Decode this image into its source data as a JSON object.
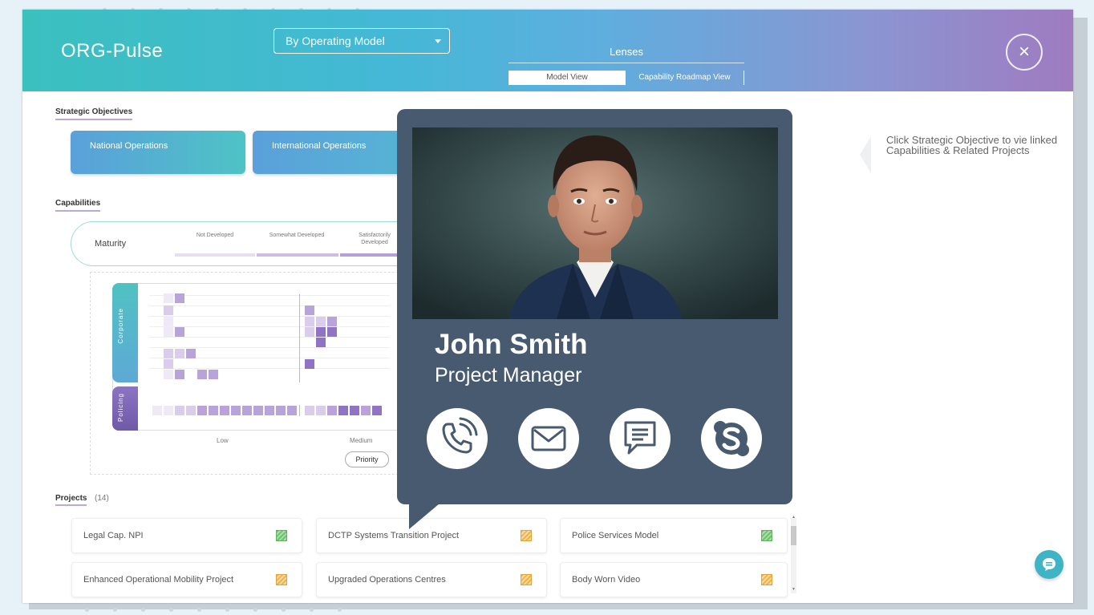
{
  "header": {
    "app_title": "ORG-Pulse",
    "view_select": "By Operating Model",
    "lenses_label": "Lenses",
    "tabs": [
      {
        "label": "Model View",
        "active": true
      },
      {
        "label": "Capability Roadmap View",
        "active": false
      }
    ],
    "close_icon": "close-icon"
  },
  "strategic_objectives": {
    "title": "Strategic Objectives",
    "items": [
      "National Operations",
      "International Operations"
    ]
  },
  "hint_text": "Click Strategic Objective to vie linked Capabilities & Related Projects",
  "capabilities": {
    "title": "Capabilities",
    "maturity_label": "Maturity",
    "maturity_levels": [
      "Not Developed",
      "Somewhat Developed",
      "Satisfactorily Developed"
    ],
    "groups": [
      "Corporate",
      "Policing"
    ],
    "priority_axis": [
      "Low",
      "Medium"
    ],
    "priority_label": "Priority"
  },
  "projects": {
    "title": "Projects",
    "count": "(14)",
    "items": [
      {
        "name": "Legal Cap. NPI",
        "status": "green"
      },
      {
        "name": "DCTP Systems Transition Project",
        "status": "orange"
      },
      {
        "name": "Police Services Model",
        "status": "green"
      },
      {
        "name": "Enhanced Operational Mobility Project",
        "status": "orange"
      },
      {
        "name": "Upgraded Operations Centres",
        "status": "orange"
      },
      {
        "name": "Body Worn Video",
        "status": "orange"
      }
    ]
  },
  "contact_card": {
    "name": "John Smith",
    "role": "Project Manager",
    "actions": [
      "phone-icon",
      "mail-icon",
      "message-icon",
      "skype-icon"
    ]
  },
  "colors": {
    "popup_bg": "#475a6f",
    "header_start": "#3bc0be",
    "header_end": "#9f7bc0",
    "status_green": "#6cc36c",
    "status_orange": "#f0b24c"
  }
}
